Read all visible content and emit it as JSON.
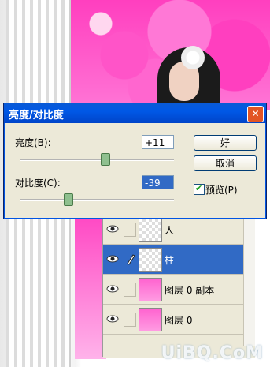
{
  "dialog": {
    "title": "亮度/对比度",
    "brightness_label": "亮度(B):",
    "brightness_value": "+11",
    "brightness_level": 0.55,
    "contrast_label": "对比度(C):",
    "contrast_value": "-39",
    "contrast_level": 0.31,
    "ok_label": "好",
    "cancel_label": "取消",
    "preview_label": "预览(P)",
    "preview_checked": true
  },
  "layers": [
    {
      "name": "人",
      "selected": false,
      "thumb": "transparent"
    },
    {
      "name": "柱",
      "selected": true,
      "thumb": "transparent"
    },
    {
      "name": "图层 0 副本",
      "selected": false,
      "thumb": "pink"
    },
    {
      "name": "图层 0",
      "selected": false,
      "thumb": "pink"
    }
  ],
  "watermark": "UiBQ.CoM",
  "colors": {
    "titlebar": "#0058e6",
    "selection": "#316ac5",
    "dialog_bg": "#ece9d8",
    "blossom": "#ff3fbf"
  }
}
